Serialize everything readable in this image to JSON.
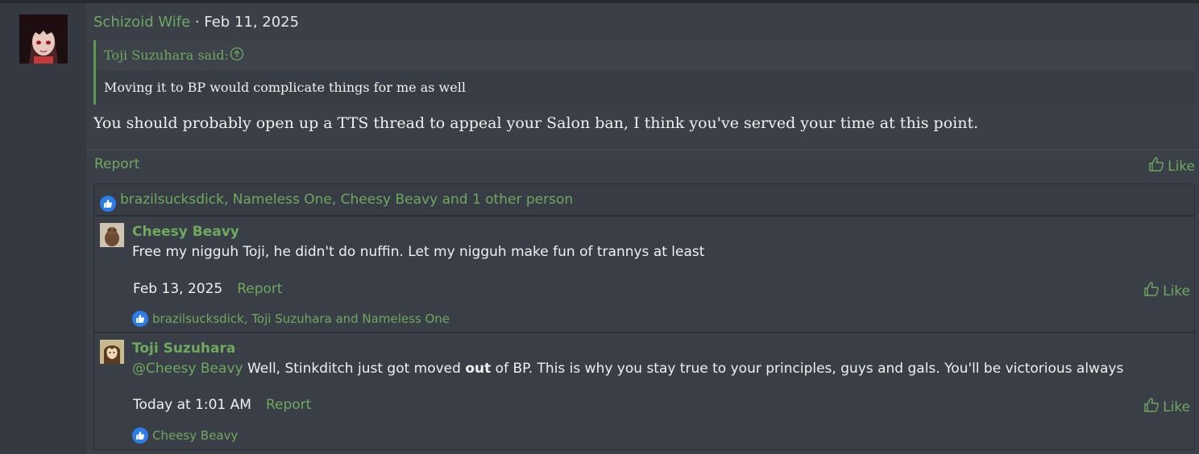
{
  "post": {
    "author": "Schizoid Wife",
    "separator": " · ",
    "date": "Feb 11, 2025",
    "quote": {
      "author_said": "Toji Suzuhara said:",
      "text": "Moving it to BP would complicate things for me as well"
    },
    "body": "You should probably open up a TTS thread to appeal your Salon ban, I think you've served your time at this point.",
    "report_label": "Report",
    "like_label": "Like",
    "reactions_text": "brazilsucksdick, Nameless One, Cheesy Beavy and 1 other person"
  },
  "comments": [
    {
      "author": "Cheesy Beavy",
      "text": "Free my nigguh Toji, he didn't do nuffin. Let my nigguh make fun of trannys at least",
      "date": "Feb 13, 2025",
      "report_label": "Report",
      "like_label": "Like",
      "reactions_text": "brazilsucksdick, Toji Suzuhara and Nameless One"
    },
    {
      "author": "Toji Suzuhara",
      "mention": "@Cheesy Beavy",
      "text_before": " Well, Stinkditch just got moved ",
      "text_bold": "out",
      "text_after": " of BP. This is why you stay true to your principles, guys and gals. You'll be victorious always",
      "date": "Today at 1:01 AM",
      "report_label": "Report",
      "like_label": "Like",
      "reactions_text": "Cheesy Beavy"
    }
  ],
  "colors": {
    "accent": "#6ea95e",
    "background": "#3b3f48",
    "reaction_badge": "#2b7de9"
  },
  "icons": {
    "quote_jump": "arrow-up-circle-icon",
    "like": "thumbs-up-outline-icon",
    "reaction": "thumbs-up-badge-icon"
  }
}
